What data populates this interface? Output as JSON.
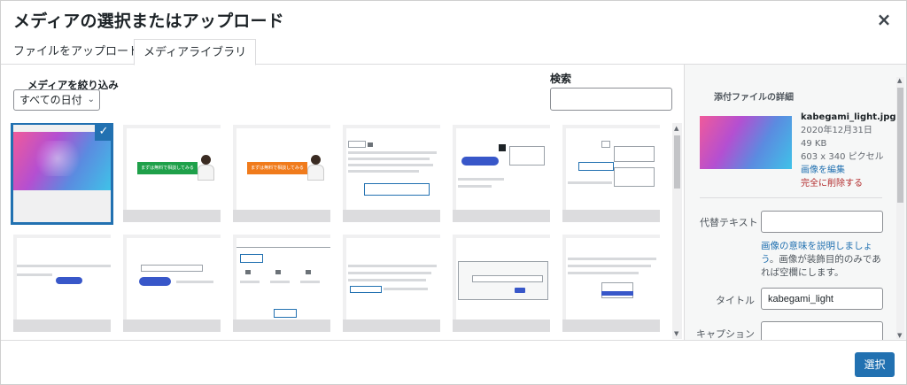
{
  "header": {
    "title": "メディアの選択またはアップロード",
    "close_label": "×"
  },
  "tabs": [
    {
      "label": "ファイルをアップロード"
    },
    {
      "label": "メディアライブラリ"
    }
  ],
  "toolbar": {
    "filter_label": "メディアを絞り込み",
    "date_filter_value": "すべての日付",
    "search_label": "検索",
    "search_value": ""
  },
  "grid": {
    "thumb_texts": {
      "cta_banner": "まずは無料で相談してみる",
      "cta_banner_2": "まずは無料で相談してみる"
    }
  },
  "sidebar": {
    "title": "添付ファイルの詳細",
    "filename": "kabegami_light.jpg",
    "date": "2020年12月31日",
    "size": "49 KB",
    "dimensions": "603 x 340 ピクセル",
    "edit_link": "画像を編集",
    "delete_link": "完全に削除する",
    "alt_label": "代替テキスト",
    "alt_value": "",
    "help_link": "画像の意味を説明しましょう",
    "help_text": "。画像が装飾目的のみであれば空欄にします。",
    "title_label": "タイトル",
    "title_value": "kabegami_light",
    "caption_label": "キャプション",
    "caption_value": ""
  },
  "footer": {
    "select_button": "選択"
  },
  "colors": {
    "accent": "#2271b1",
    "delete": "#b32d2e"
  }
}
